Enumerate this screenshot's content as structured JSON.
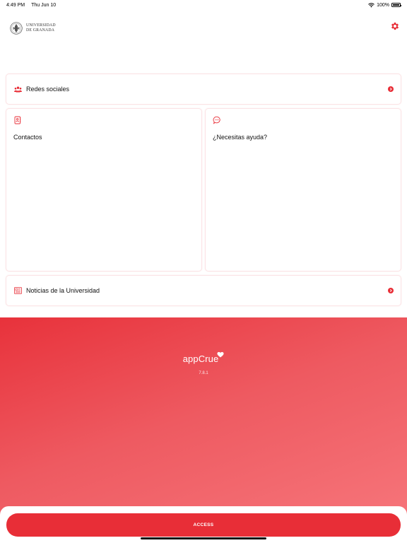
{
  "status_bar": {
    "time": "4:49 PM",
    "date": "Thu Jun 10",
    "battery": "100%"
  },
  "header": {
    "logo_line1": "UNIVERSIDAD",
    "logo_line2": "DE GRANADA"
  },
  "menu": {
    "social": "Redes sociales",
    "contacts": "Contactos",
    "help": "¿Necesitas ayuda?",
    "news": "Noticias de la Universidad"
  },
  "brand": {
    "name": "appCrue",
    "version": "7.8.1"
  },
  "access": {
    "label": "ACCESS"
  },
  "colors": {
    "accent": "#e82e37",
    "card_border": "#fbe3e5"
  },
  "icons": [
    "wifi-icon",
    "battery-icon",
    "gear-icon",
    "group-icon",
    "contacts-book-icon",
    "chat-help-icon",
    "news-icon",
    "chevron-right-icon",
    "heart-icon"
  ]
}
